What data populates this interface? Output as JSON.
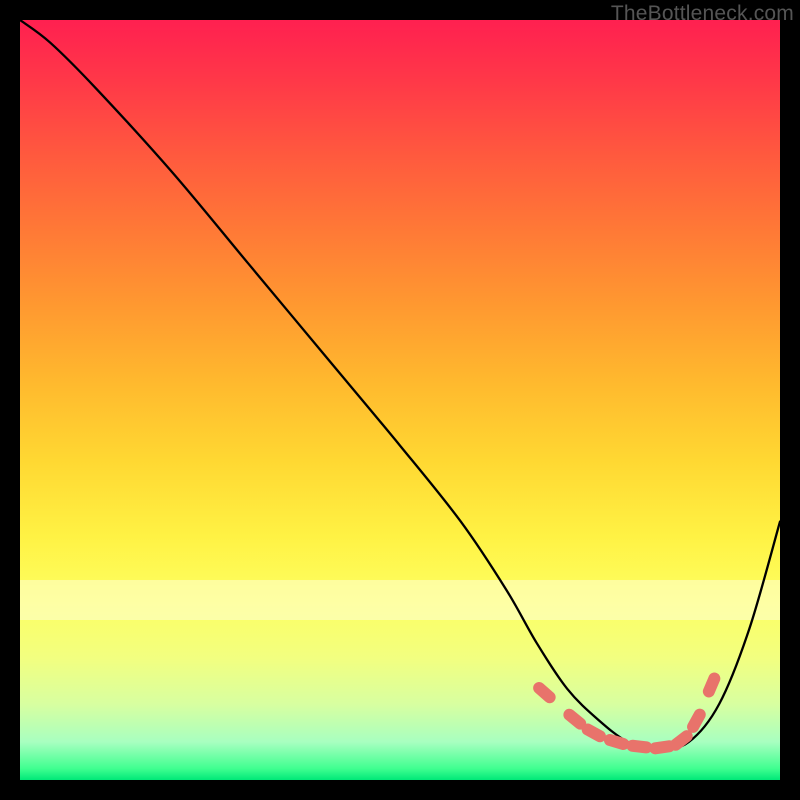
{
  "watermark": "TheBottleneck.com",
  "chart_data": {
    "type": "line",
    "title": "",
    "xlabel": "",
    "ylabel": "",
    "xlim": [
      0,
      100
    ],
    "ylim": [
      0,
      100
    ],
    "grid": false,
    "series": [
      {
        "name": "bottleneck-curve",
        "x": [
          0,
          4,
          10,
          20,
          30,
          40,
          50,
          58,
          64,
          68,
          72,
          76,
          80,
          84,
          88,
          92,
          96,
          100
        ],
        "values": [
          100,
          97,
          91,
          80,
          68,
          56,
          44,
          34,
          25,
          18,
          12,
          8,
          5,
          4,
          5,
          10,
          20,
          34
        ]
      }
    ],
    "markers": {
      "name": "optimal-range",
      "shape": "pill",
      "color": "#e8736b",
      "x": [
        69,
        73,
        75.5,
        78.5,
        81.5,
        84.5,
        87,
        89,
        91
      ],
      "values": [
        11.5,
        8,
        6.2,
        5.0,
        4.4,
        4.3,
        5.2,
        7.8,
        12.5
      ]
    }
  }
}
